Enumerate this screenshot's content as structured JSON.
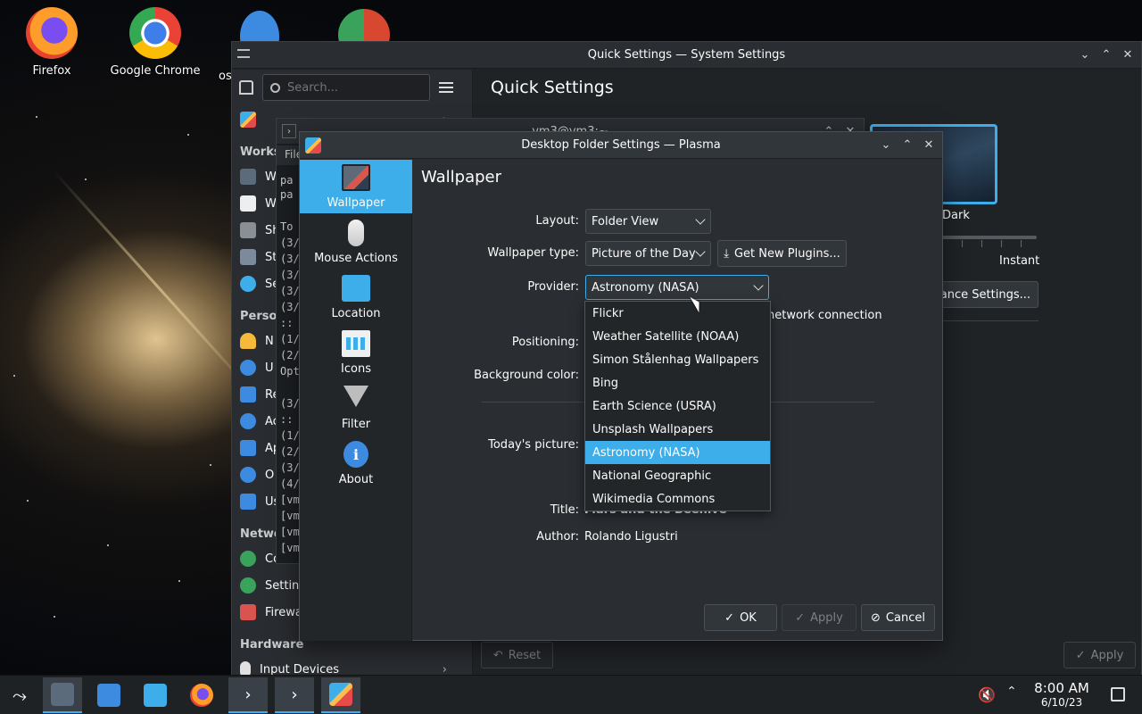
{
  "desktop": {
    "icons": [
      {
        "label": "Firefox",
        "icon": "firefox-icon"
      },
      {
        "label": "Google Chrome",
        "icon": "chrome-icon"
      },
      {
        "label": "os",
        "icon": "document-icon"
      }
    ]
  },
  "system_settings": {
    "title": "Quick Settings — System Settings",
    "search_placeholder": "Search...",
    "page_title": "Quick Settings",
    "sections": {
      "workspace": "Works",
      "personalization": "Person",
      "network": "Netwo",
      "hardware": "Hardware"
    },
    "items": {
      "w1": "W",
      "w2": "W",
      "sh": "Sh",
      "st": "St",
      "se": "Se",
      "n": "N",
      "u": "U",
      "re": "Re",
      "ac": "Ac",
      "ap": "Ap",
      "o": "O",
      "us": "Us",
      "conn": "Conne",
      "settings": "Settin",
      "firewall": "Firewa",
      "input": "Input Devices"
    },
    "theme_label": "Dark",
    "animation_speed": "Instant",
    "appearance_settings": "arance Settings...",
    "network_connection": "network connection",
    "reset_label": "Reset",
    "apply_label": "Apply"
  },
  "terminal": {
    "title": "vm3@vm3:~",
    "file_menu": "File",
    "lines": [
      "pa",
      "pa",
      "To",
      "(3/",
      "(3/",
      "(3/",
      "(3/",
      "(3/",
      "::",
      "(1/",
      "(2/",
      "Opt",
      "(3/",
      "::",
      "(1/",
      "(2/",
      "(3/",
      "(4/",
      "[vm",
      "[vm",
      "[vm",
      "[vm"
    ]
  },
  "dialog": {
    "title": "Desktop Folder Settings — Plasma",
    "nav": [
      {
        "label": "Wallpaper",
        "icon": "wallpaper-icon"
      },
      {
        "label": "Mouse Actions",
        "icon": "mouse-icon"
      },
      {
        "label": "Location",
        "icon": "folder-icon"
      },
      {
        "label": "Icons",
        "icon": "icons-icon"
      },
      {
        "label": "Filter",
        "icon": "filter-icon"
      },
      {
        "label": "About",
        "icon": "info-icon"
      }
    ],
    "heading": "Wallpaper",
    "layout_label": "Layout:",
    "layout_value": "Folder View",
    "wallpaper_type_label": "Wallpaper type:",
    "wallpaper_type_value": "Picture of the Day",
    "get_plugins_label": "Get New Plugins...",
    "provider_label": "Provider:",
    "provider_value": "Astronomy (NASA)",
    "positioning_label": "Positioning:",
    "background_color_label": "Background color:",
    "todays_picture_label": "Today's picture:",
    "title_label": "Title:",
    "title_value": "Mars and the Beehive",
    "author_label": "Author:",
    "author_value": "Rolando Ligustri",
    "ok_label": "OK",
    "apply_label": "Apply",
    "cancel_label": "Cancel",
    "provider_options": [
      "Flickr",
      "Weather Satellite (NOAA)",
      "Simon Stålenhag Wallpapers",
      "Bing",
      "Earth Science (USRA)",
      "Unsplash Wallpapers",
      "Astronomy (NASA)",
      "National Geographic",
      "Wikimedia Commons"
    ],
    "selected_option_index": 6
  },
  "taskbar": {
    "time": "8:00 AM",
    "date": "6/10/23"
  },
  "colors": {
    "accent": "#3daee9",
    "window_bg": "#2a2e32"
  }
}
